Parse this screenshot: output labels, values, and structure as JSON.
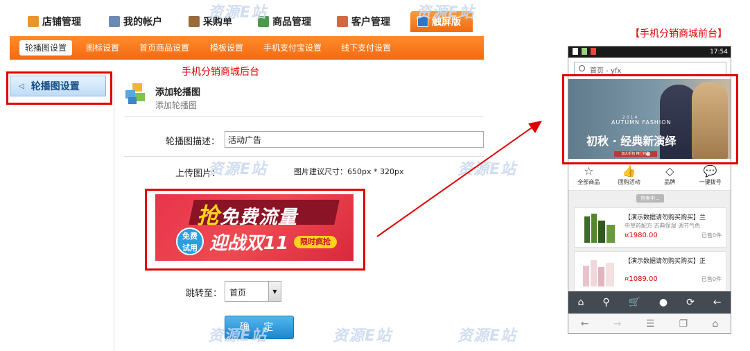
{
  "top_nav": {
    "tabs": [
      {
        "label": "店铺管理",
        "icon": "shop-icon",
        "color": "#e8962a"
      },
      {
        "label": "我的帐户",
        "icon": "account-icon",
        "color": "#6b8bb5"
      },
      {
        "label": "采购单",
        "icon": "purchase-order-icon",
        "color": "#9a6b3a"
      },
      {
        "label": "商品管理",
        "icon": "goods-cube-icon",
        "color": "#4a9a4a"
      },
      {
        "label": "客户管理",
        "icon": "customer-icon",
        "color": "#d06a40"
      },
      {
        "label": "触屏版",
        "icon": "touchscreen-icon",
        "color": "#2e74c8"
      }
    ],
    "active_tab": "触屏版"
  },
  "sub_nav": {
    "items": [
      "轮播图设置",
      "图标设置",
      "首页商品设置",
      "模板设置",
      "手机支付宝设置",
      "线下支付设置"
    ],
    "active_item": "轮播图设置"
  },
  "sidebar": {
    "button_label": "轮播图设置",
    "icon": "chevron-left-icon"
  },
  "annotations": {
    "backend": "手机分销商城后台",
    "frontend": "【手机分销商城前台】",
    "highlight_color": "#e00000"
  },
  "page_header": {
    "title": "添加轮播图",
    "subtitle": "添加轮播图"
  },
  "form": {
    "description_label": "轮播图描述：",
    "description_value": "活动广告",
    "upload_label": "上传图片：",
    "size_hint": "图片建议尺寸：650px * 320px",
    "redirect_label": "跳转至：",
    "redirect_value": "首页",
    "submit_label": "确 定"
  },
  "banner_image": {
    "headline_first": "抢",
    "headline_rest": "免费流量",
    "circle_text_line1": "免费",
    "circle_text_line2": "试用",
    "subline": "迎战双11",
    "pill": "限时疯抢"
  },
  "watermark": "资源E站",
  "phone": {
    "status_time": "17:54",
    "search_text": "首页 - yfx",
    "hero": {
      "year": "2014",
      "season": "AUTUMN FASHION",
      "headline": "初秋 · 经典新演绎",
      "button": "加大折扣 精彩抢购"
    },
    "icon_row": [
      {
        "label": "全部商品",
        "icon": "star-icon",
        "glyph": "☆"
      },
      {
        "label": "团购活动",
        "icon": "thumbs-up-icon",
        "glyph": "👍"
      },
      {
        "label": "品牌",
        "icon": "diamond-icon",
        "glyph": "◇"
      },
      {
        "label": "一键拨号",
        "icon": "chat-bubble-icon",
        "glyph": "💬"
      }
    ],
    "section_tag": "热卖中...",
    "products": [
      {
        "name": "【演示数据请勿购买购买】兰",
        "desc": "中草药配方 古典保湿 调节气色",
        "price": "¤1980.00",
        "sold": "已售0件"
      },
      {
        "name": "【演示数据请勿购买购买】正",
        "desc": "",
        "price": "¤1089.00",
        "sold": "已售0件"
      }
    ],
    "tab_bar": [
      {
        "icon": "home-icon",
        "glyph": "⌂"
      },
      {
        "icon": "search-icon",
        "glyph": "⚲"
      },
      {
        "icon": "cart-icon",
        "glyph": "🛒"
      },
      {
        "icon": "user-icon",
        "glyph": "●"
      },
      {
        "icon": "refresh-icon",
        "glyph": "⟳"
      },
      {
        "icon": "back-arrow-icon",
        "glyph": "←"
      }
    ],
    "browser_bar": [
      {
        "icon": "browser-back-icon",
        "glyph": "←"
      },
      {
        "icon": "browser-forward-icon",
        "glyph": "→"
      },
      {
        "icon": "menu-icon",
        "glyph": "☰"
      },
      {
        "icon": "tabs-icon",
        "glyph": "❐"
      },
      {
        "icon": "browser-home-icon",
        "glyph": "⌂"
      }
    ]
  }
}
